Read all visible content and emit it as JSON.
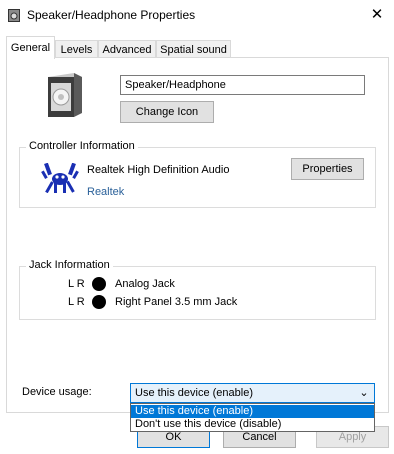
{
  "window": {
    "title": "Speaker/Headphone Properties"
  },
  "tabs": [
    {
      "label": "General",
      "active": true
    },
    {
      "label": "Levels"
    },
    {
      "label": "Advanced"
    },
    {
      "label": "Spatial sound"
    }
  ],
  "general": {
    "device_name_value": "Speaker/Headphone",
    "change_icon_label": "Change Icon"
  },
  "controller": {
    "group_label": "Controller Information",
    "device": "Realtek High Definition Audio",
    "vendor": "Realtek",
    "properties_label": "Properties"
  },
  "jack": {
    "group_label": "Jack Information",
    "rows": [
      {
        "lr": "L R",
        "name": "Analog Jack"
      },
      {
        "lr": "L R",
        "name": "Right Panel 3.5 mm Jack"
      }
    ]
  },
  "usage": {
    "label": "Device usage:",
    "selected": "Use this device (enable)",
    "options": [
      "Use this device (enable)",
      "Don't use this device (disable)"
    ]
  },
  "footer": {
    "ok": "OK",
    "cancel": "Cancel",
    "apply": "Apply"
  },
  "colors": {
    "accent": "#0078d7",
    "link": "#2a6099",
    "realtek_blue": "#1a2fb3"
  }
}
